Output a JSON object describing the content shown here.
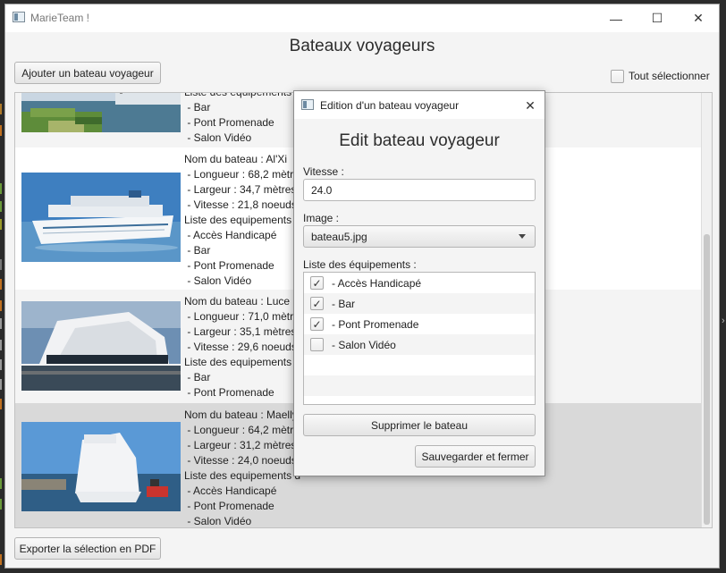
{
  "window": {
    "title": "MarieTeam !",
    "controls": {
      "minimize": "—",
      "maximize": "☐",
      "close": "✕"
    }
  },
  "page": {
    "title": "Bateaux voyageurs",
    "add_button": "Ajouter un bateau voyageur",
    "select_all_label": "Tout sélectionner",
    "export_button": "Exporter la sélection en PDF"
  },
  "list": {
    "rows": [
      {
        "lines": [
          "Liste des equipements d",
          " - Bar",
          " - Pont Promenade",
          " - Salon Vidéo"
        ]
      },
      {
        "lines": [
          "Nom du bateau : Al'Xi",
          " - Longueur : 68,2 mètres",
          " - Largeur : 34,7 mètres",
          " - Vitesse : 21,8 noeuds",
          "Liste des equipements d",
          " - Accès Handicapé",
          " - Bar",
          " - Pont Promenade",
          " - Salon Vidéo"
        ]
      },
      {
        "lines": [
          "Nom du bateau : Luce i",
          " - Longueur : 71,0 mètres",
          " - Largeur : 35,1 mètres",
          " - Vitesse : 29,6 noeuds",
          "Liste des equipements d",
          " - Bar",
          " - Pont Promenade"
        ]
      },
      {
        "lines": [
          "Nom du bateau : Maelly",
          " - Longueur : 64,2 mètres",
          " - Largeur : 31,2 mètres",
          " - Vitesse : 24,0 noeuds",
          "Liste des equipements d",
          " - Accès Handicapé",
          " - Pont Promenade",
          " - Salon Vidéo"
        ]
      }
    ]
  },
  "dialog": {
    "window_title": "Edition d'un bateau voyageur",
    "close": "✕",
    "heading": "Edit bateau voyageur",
    "speed_label": "Vitesse :",
    "speed_value": "24.0",
    "image_label": "Image :",
    "image_value": "bateau5.jpg",
    "equipments_label": "Liste des équipements :",
    "equipments": [
      {
        "label": "- Accès Handicapé",
        "checked": true
      },
      {
        "label": "- Bar",
        "checked": true
      },
      {
        "label": "- Pont Promenade",
        "checked": true
      },
      {
        "label": "- Salon Vidéo",
        "checked": false
      }
    ],
    "check_mark": "✓",
    "delete_button": "Supprimer le bateau",
    "save_button": "Sauvegarder et fermer"
  },
  "colors": {
    "row_alt": "#f4f4f4",
    "row_selected": "#d9d9d9",
    "window_bg": "#f4f4f4"
  }
}
